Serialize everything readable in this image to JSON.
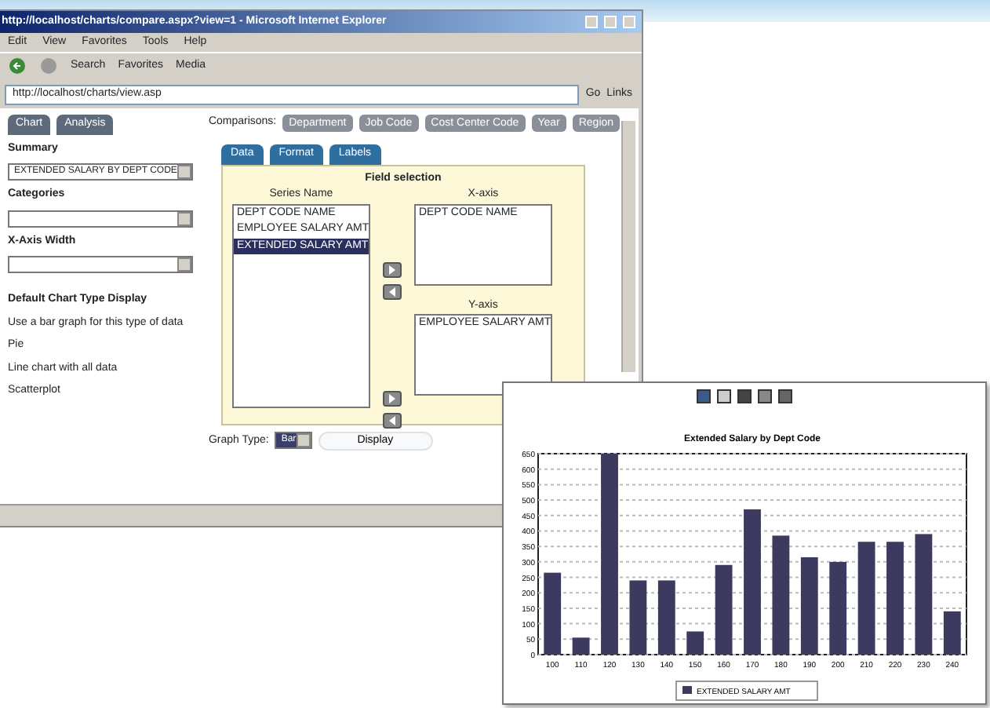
{
  "browser": {
    "title": "http://localhost/charts/compare.aspx?view=1 - Microsoft Internet Explorer",
    "menu": [
      "Edit",
      "View",
      "Favorites",
      "Tools",
      "Help"
    ],
    "toolbar": [
      "Search",
      "Favorites",
      "Media"
    ],
    "address": "http://localhost/charts/view.asp",
    "go": "Go",
    "links": "Links"
  },
  "left_tabs": [
    "Chart",
    "Analysis"
  ],
  "fields": [
    {
      "label": "Summary",
      "value": "EXTENDED SALARY BY DEPT CODE"
    },
    {
      "label": "Categories"
    },
    {
      "label": "X-Axis Width"
    }
  ],
  "options_title": "Default Chart Type Display",
  "options": [
    "Use a bar graph for this type of data",
    "Pie",
    "Line chart with all data",
    "Scatterplot"
  ],
  "comparisons": {
    "label": "Comparisons:",
    "buttons": [
      "Department",
      "Job Code",
      "Cost Center Code",
      "Year",
      "Region"
    ]
  },
  "panel": {
    "tabs": [
      "Data",
      "Format",
      "Labels"
    ],
    "heading": "Field selection",
    "series_label": "Series Name",
    "series": [
      {
        "label": "DEPT CODE NAME",
        "selected": false
      },
      {
        "label": "EMPLOYEE SALARY AMT",
        "selected": false
      },
      {
        "label": "EXTENDED SALARY AMT",
        "selected": true
      }
    ],
    "x_label": "X-axis",
    "x_items": [
      "DEPT CODE NAME"
    ],
    "y_label": "Y-axis",
    "y_items": [
      "EMPLOYEE SALARY AMT"
    ],
    "graph_type_label": "Graph Type:",
    "graph_type": "Bar",
    "display_button": "Display"
  },
  "chart": {
    "chart_data": {
      "type": "bar",
      "title": "Extended Salary by Dept Code",
      "categories": [
        "100",
        "110",
        "120",
        "130",
        "140",
        "150",
        "160",
        "170",
        "180",
        "190",
        "200",
        "210",
        "220",
        "230",
        "240"
      ],
      "series": [
        {
          "name": "EXTENDED SALARY AMT",
          "color": "#3c3a5e",
          "values": [
            265,
            55,
            650,
            240,
            240,
            75,
            290,
            470,
            385,
            315,
            300,
            365,
            365,
            390,
            140
          ]
        }
      ],
      "grid": true,
      "ylim": [
        0,
        650
      ],
      "yticks": [
        0,
        50,
        100,
        150,
        200,
        250,
        300,
        350,
        400,
        450,
        500,
        550,
        600,
        650
      ]
    }
  }
}
